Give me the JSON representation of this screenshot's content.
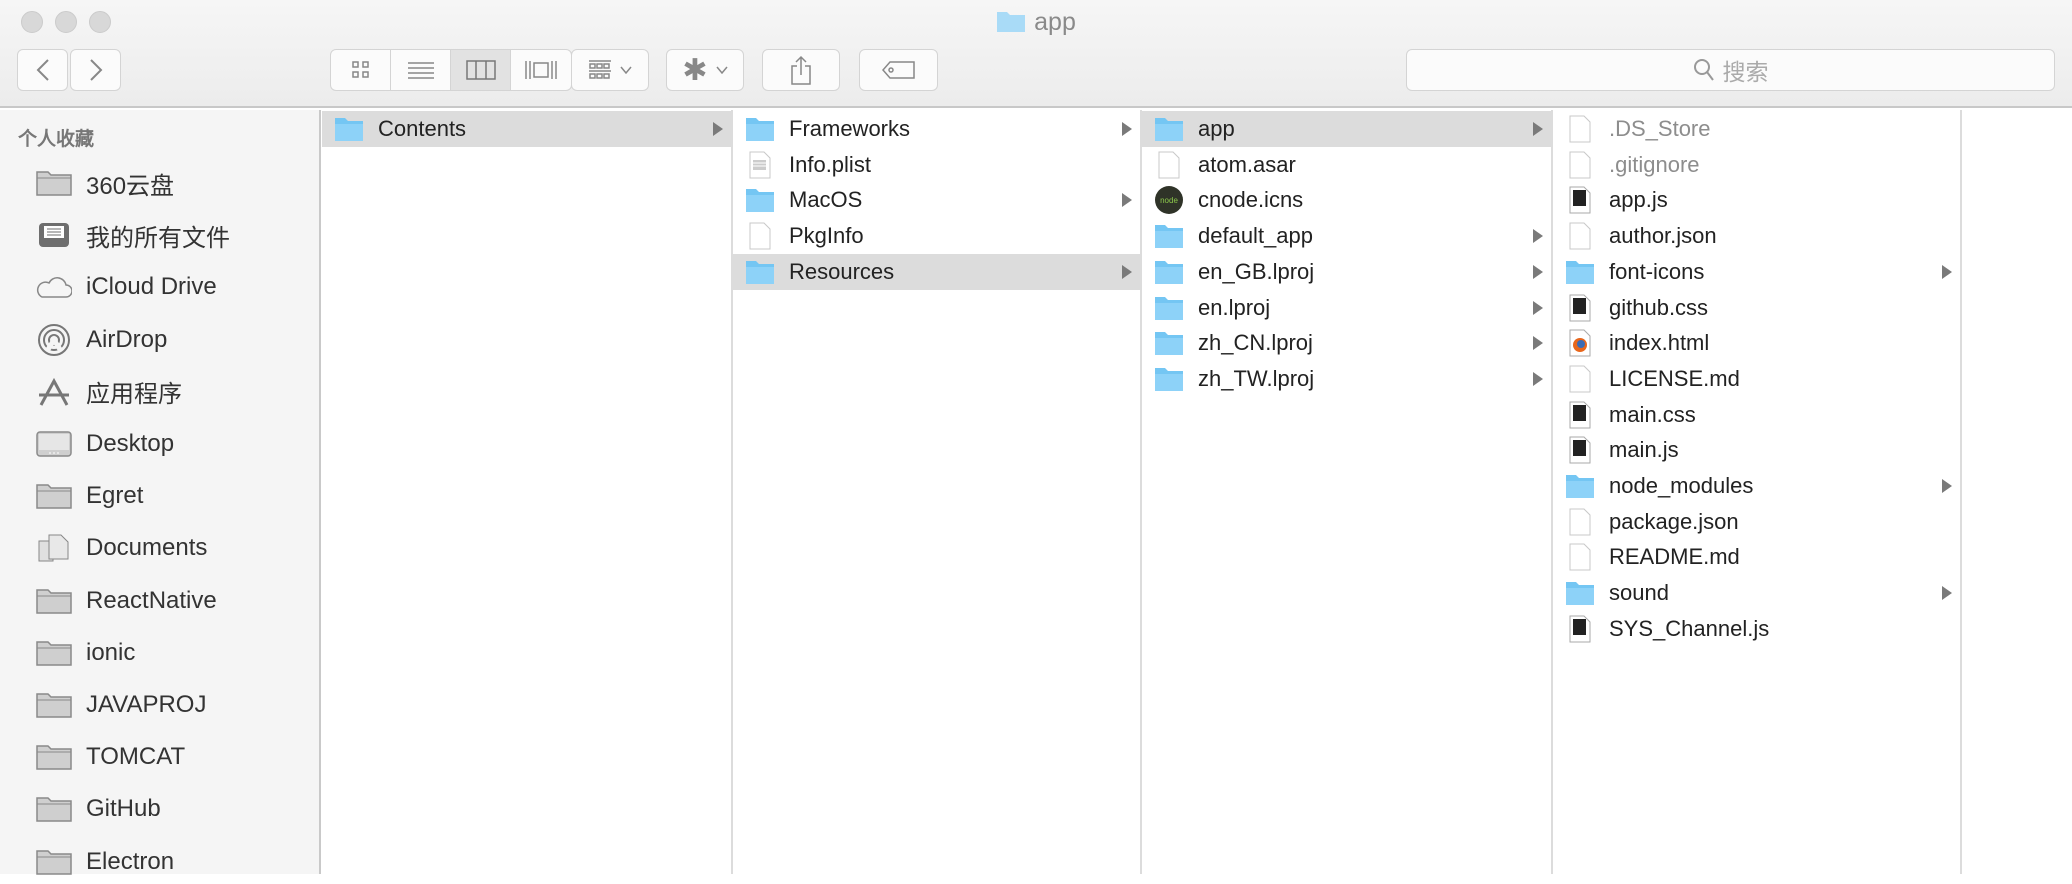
{
  "window": {
    "title": "app"
  },
  "toolbar": {
    "search_placeholder": "搜索",
    "view_modes": [
      "icon",
      "list",
      "column",
      "cover-flow"
    ],
    "active_view": "column"
  },
  "sidebar": {
    "header": "个人收藏",
    "items": [
      {
        "label": "360云盘",
        "icon": "folder"
      },
      {
        "label": "我的所有文件",
        "icon": "all-files"
      },
      {
        "label": "iCloud Drive",
        "icon": "cloud"
      },
      {
        "label": "AirDrop",
        "icon": "airdrop"
      },
      {
        "label": "应用程序",
        "icon": "applications"
      },
      {
        "label": "Desktop",
        "icon": "desktop"
      },
      {
        "label": "Egret",
        "icon": "folder"
      },
      {
        "label": "Documents",
        "icon": "documents"
      },
      {
        "label": "ReactNative",
        "icon": "folder"
      },
      {
        "label": "ionic",
        "icon": "folder"
      },
      {
        "label": "JAVAPROJ",
        "icon": "folder"
      },
      {
        "label": "TOMCAT",
        "icon": "folder"
      },
      {
        "label": "GitHub",
        "icon": "folder"
      },
      {
        "label": "Electron",
        "icon": "folder"
      }
    ]
  },
  "columns": [
    [
      {
        "name": "Contents",
        "type": "folder",
        "selected": true
      }
    ],
    [
      {
        "name": "Frameworks",
        "type": "folder"
      },
      {
        "name": "Info.plist",
        "type": "plist"
      },
      {
        "name": "MacOS",
        "type": "folder"
      },
      {
        "name": "PkgInfo",
        "type": "file"
      },
      {
        "name": "Resources",
        "type": "folder",
        "selected": true
      }
    ],
    [
      {
        "name": "app",
        "type": "folder",
        "selected": true
      },
      {
        "name": "atom.asar",
        "type": "file"
      },
      {
        "name": "cnode.icns",
        "type": "node"
      },
      {
        "name": "default_app",
        "type": "folder"
      },
      {
        "name": "en_GB.lproj",
        "type": "folder"
      },
      {
        "name": "en.lproj",
        "type": "folder"
      },
      {
        "name": "zh_CN.lproj",
        "type": "folder"
      },
      {
        "name": "zh_TW.lproj",
        "type": "folder"
      }
    ],
    [
      {
        "name": ".DS_Store",
        "type": "file",
        "hidden": true
      },
      {
        "name": ".gitignore",
        "type": "file",
        "hidden": true
      },
      {
        "name": "app.js",
        "type": "code"
      },
      {
        "name": "author.json",
        "type": "file"
      },
      {
        "name": "font-icons",
        "type": "folder"
      },
      {
        "name": "github.css",
        "type": "code"
      },
      {
        "name": "index.html",
        "type": "html"
      },
      {
        "name": "LICENSE.md",
        "type": "file"
      },
      {
        "name": "main.css",
        "type": "code"
      },
      {
        "name": "main.js",
        "type": "code"
      },
      {
        "name": "node_modules",
        "type": "folder"
      },
      {
        "name": "package.json",
        "type": "file"
      },
      {
        "name": "README.md",
        "type": "file"
      },
      {
        "name": "sound",
        "type": "folder"
      },
      {
        "name": "SYS_Channel.js",
        "type": "code"
      }
    ]
  ],
  "colors": {
    "folder": "#74c6f3",
    "selection": "#dcdcdc"
  }
}
